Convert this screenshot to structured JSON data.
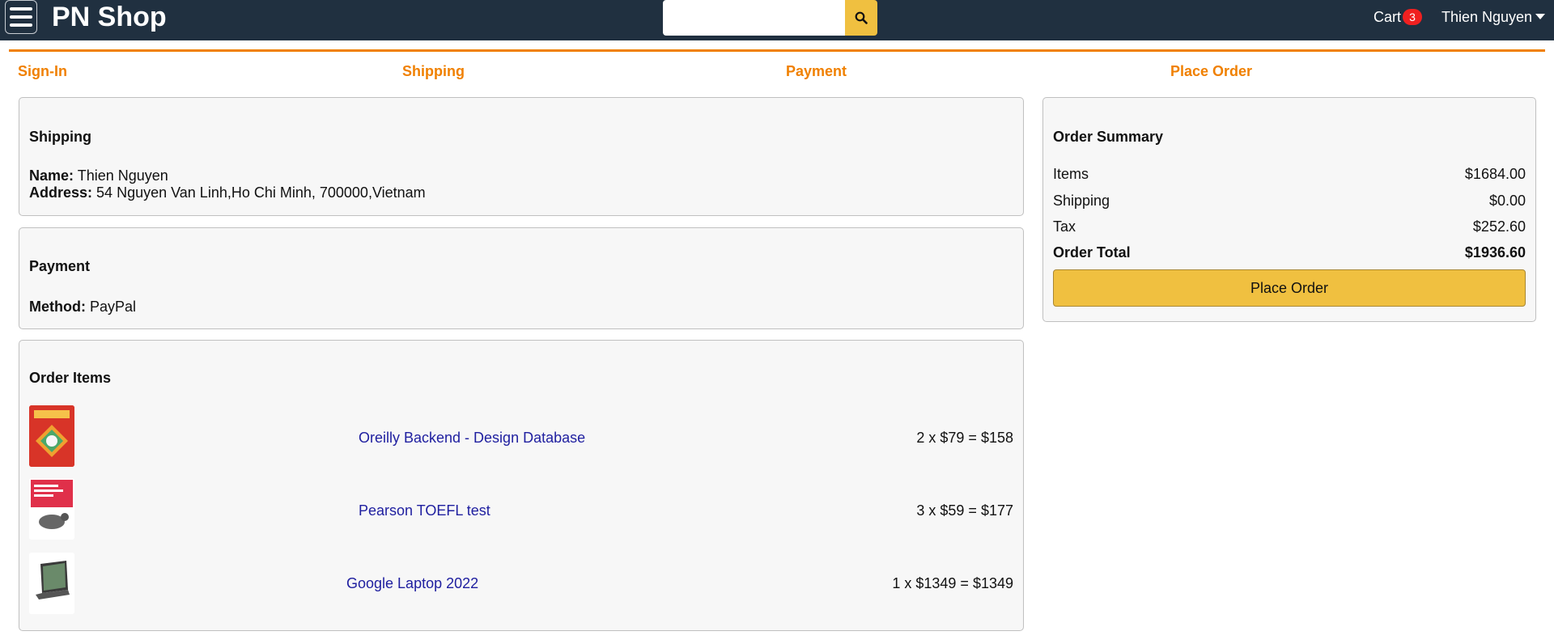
{
  "header": {
    "brand": "PN Shop",
    "search": {
      "value": "",
      "placeholder": ""
    },
    "cart": {
      "label": "Cart",
      "count": "3"
    },
    "user": {
      "name": "Thien Nguyen"
    }
  },
  "steps": [
    "Sign-In",
    "Shipping",
    "Payment",
    "Place Order"
  ],
  "shipping": {
    "title": "Shipping",
    "name_label": "Name:",
    "name": "Thien Nguyen",
    "address_label": "Address:",
    "address": "54 Nguyen Van Linh,Ho Chi Minh, 700000,Vietnam"
  },
  "payment": {
    "title": "Payment",
    "method_label": "Method:",
    "method": "PayPal"
  },
  "order_items": {
    "title": "Order Items",
    "items": [
      {
        "name": "Oreilly Backend - Design Database",
        "price": "2 x $79 = $158"
      },
      {
        "name": "Pearson TOEFL test",
        "price": "3 x $59 = $177"
      },
      {
        "name": "Google Laptop 2022",
        "price": "1 x $1349 = $1349"
      }
    ]
  },
  "summary": {
    "title": "Order Summary",
    "rows": [
      {
        "label": "Items",
        "value": "$1684.00"
      },
      {
        "label": "Shipping",
        "value": "$0.00"
      },
      {
        "label": "Tax",
        "value": "$252.60"
      },
      {
        "label": "Order Total",
        "value": "$1936.60"
      }
    ],
    "button": "Place Order"
  },
  "colors": {
    "header": "#203040",
    "accent": "#f08000",
    "button": "#f0c040",
    "link": "#2020a0"
  }
}
